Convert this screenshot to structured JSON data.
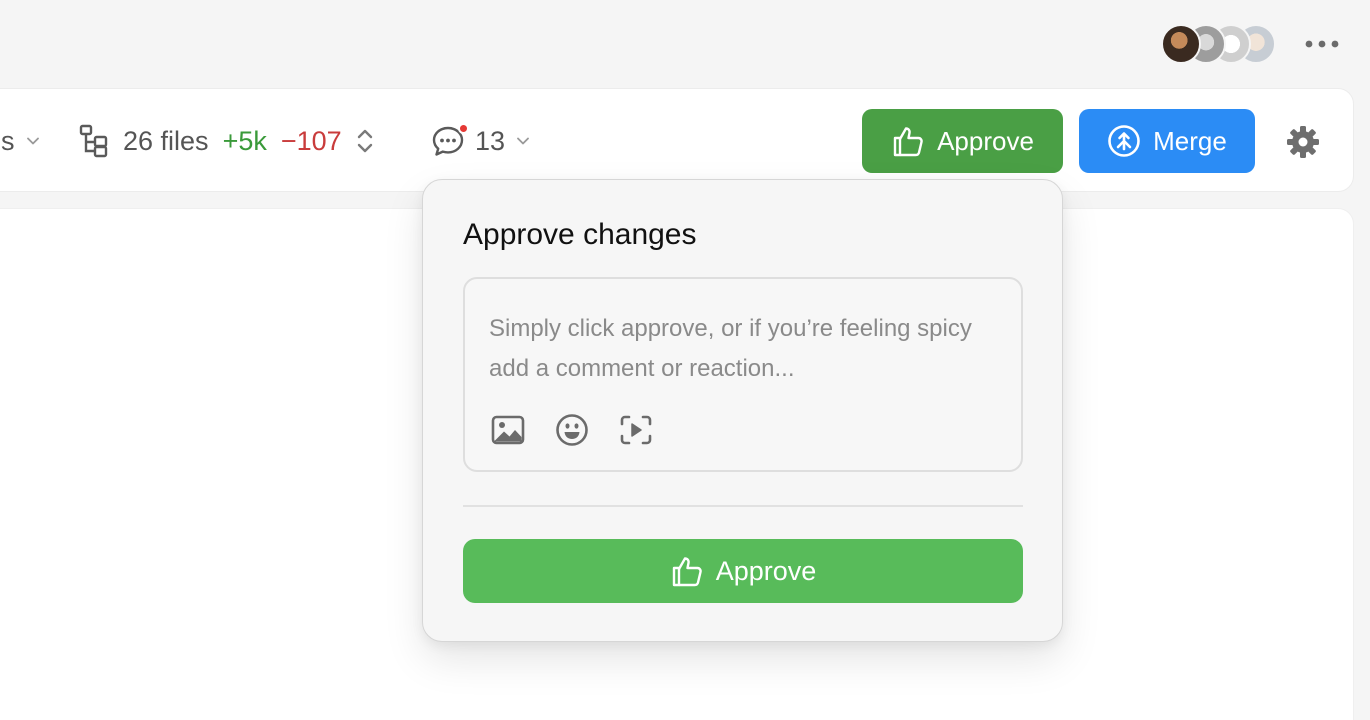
{
  "header": {
    "avatars": [
      "avatar-1",
      "avatar-2",
      "avatar-3",
      "avatar-4"
    ],
    "more_icon": "more-horizontal-icon"
  },
  "toolbar": {
    "cut_label": "s",
    "files": {
      "count_label": "26 files",
      "added": "+5k",
      "removed": "−107"
    },
    "comments": {
      "count": "13",
      "has_unread": true
    },
    "approve_label": "Approve",
    "merge_label": "Merge",
    "settings_icon": "gear-icon"
  },
  "popover": {
    "title": "Approve changes",
    "placeholder": "Simply click approve, or if you’re feeling spicy add a comment or reaction...",
    "value": "",
    "tools": [
      "image-icon",
      "emoji-icon",
      "video-capture-icon"
    ],
    "approve_label": "Approve"
  },
  "colors": {
    "approve_top": "#4a9f45",
    "approve_main": "#58bb5a",
    "merge": "#2b8cf5",
    "added": "#3a9a3a",
    "removed": "#c93c3c",
    "unread_dot": "#e53935"
  }
}
